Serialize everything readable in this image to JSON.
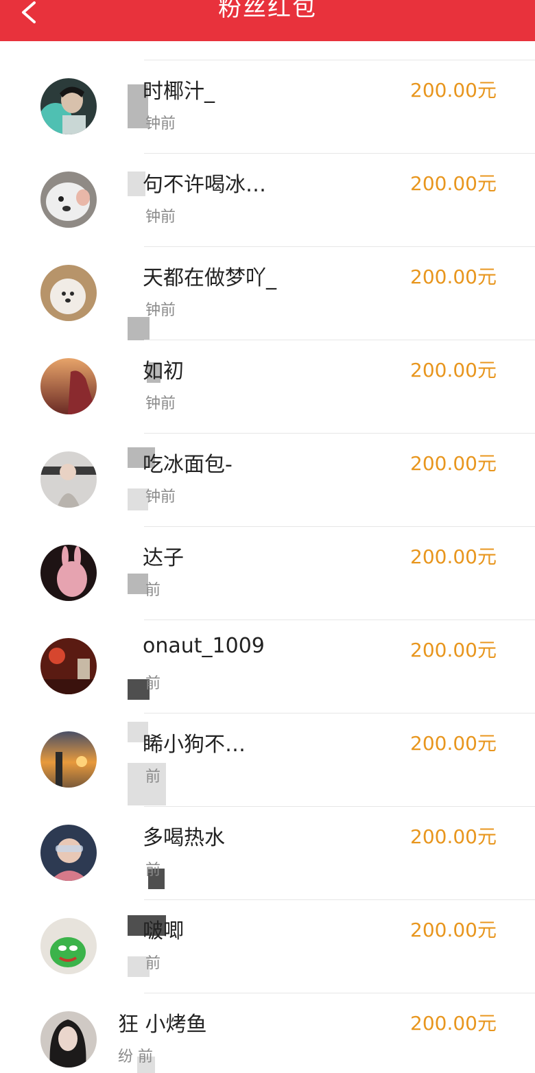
{
  "header": {
    "title": "粉丝红包",
    "back_icon": "chevron-left-icon",
    "background": "#e8323c"
  },
  "colors": {
    "amount": "#e8961e",
    "name": "#222222",
    "time": "#8a8a8a"
  },
  "rows": [
    {
      "name": "时椰汁_",
      "time": "钟前",
      "amount": "200.00元"
    },
    {
      "name": "句不许喝冰…",
      "time": "钟前",
      "amount": "200.00元"
    },
    {
      "name": "天都在做梦吖_",
      "time": "钟前",
      "amount": "200.00元"
    },
    {
      "name": "如初",
      "time": "钟前",
      "amount": "200.00元"
    },
    {
      "name": "吃冰面包-",
      "time": "钟前",
      "amount": "200.00元"
    },
    {
      "name": "达子",
      "time": "前",
      "amount": "200.00元"
    },
    {
      "name": "onaut_1009",
      "time": "前",
      "amount": "200.00元"
    },
    {
      "name": "睎小狗不…",
      "time": "前",
      "amount": "200.00元"
    },
    {
      "name": "多喝热水",
      "time": "前",
      "amount": "200.00元"
    },
    {
      "name": "啵唧",
      "time": "前",
      "amount": "200.00元"
    },
    {
      "name": "狂 小烤鱼",
      "time": "纷 前",
      "amount": "200.00元"
    }
  ]
}
